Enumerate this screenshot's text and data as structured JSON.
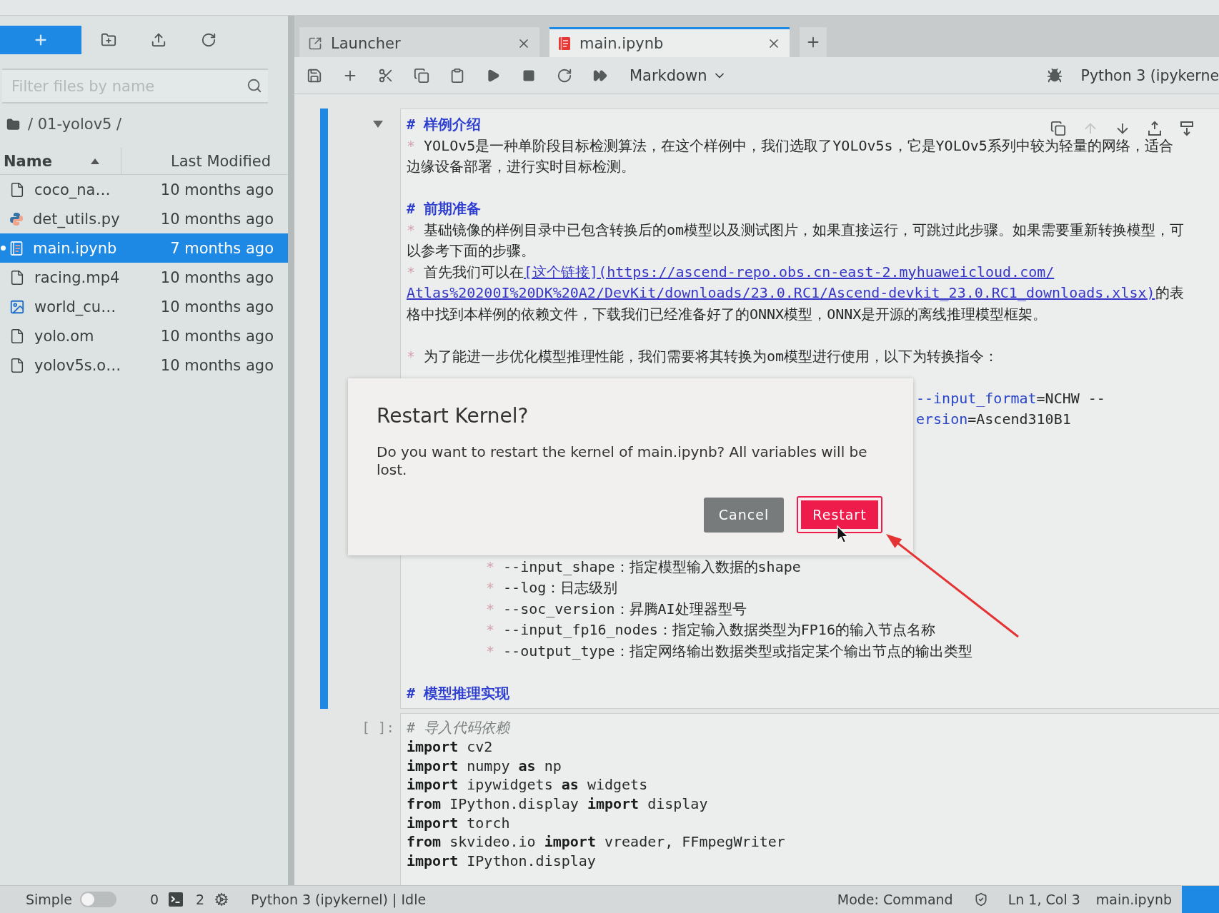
{
  "sidebar": {
    "filter": {
      "placeholder": "Filter files by name"
    },
    "path": "/ 01-yolov5 /",
    "columns": [
      {
        "label": "Name",
        "sorted": true
      },
      {
        "label": "Last Modified",
        "sorted": false
      }
    ],
    "files": [
      {
        "name": "coco_na…",
        "modified": "10 months ago",
        "kind": "file",
        "selected": false,
        "running": false
      },
      {
        "name": "det_utils.py",
        "modified": "10 months ago",
        "kind": "python",
        "selected": false,
        "running": false
      },
      {
        "name": "main.ipynb",
        "modified": "7 months ago",
        "kind": "notebook",
        "selected": true,
        "running": true
      },
      {
        "name": "racing.mp4",
        "modified": "10 months ago",
        "kind": "file",
        "selected": false,
        "running": false
      },
      {
        "name": "world_cu…",
        "modified": "10 months ago",
        "kind": "image",
        "selected": false,
        "running": false
      },
      {
        "name": "yolo.om",
        "modified": "10 months ago",
        "kind": "file",
        "selected": false,
        "running": false
      },
      {
        "name": "yolov5s.o…",
        "modified": "10 months ago",
        "kind": "file",
        "selected": false,
        "running": false
      }
    ]
  },
  "tabs": [
    {
      "label": "Launcher",
      "kind": "launcher",
      "selected": false
    },
    {
      "label": "main.ipynb",
      "kind": "notebook",
      "selected": true
    }
  ],
  "toolbar": {
    "cell_type": "Markdown",
    "kernel": "Python 3 (ipykerne"
  },
  "markdown_cell": {
    "selected": true,
    "cell_toolbar": [
      {
        "kind": "duplicate",
        "disabled": false
      },
      {
        "kind": "move_up",
        "disabled": true
      },
      {
        "kind": "move_down",
        "disabled": false
      },
      {
        "kind": "insert_above",
        "disabled": false
      },
      {
        "kind": "insert_below",
        "disabled": false
      }
    ],
    "lines": [
      {
        "kind": "heading",
        "segments": [
          {
            "text": "# 样例介绍",
            "kind": "plain"
          }
        ]
      },
      {
        "kind": "item",
        "marker": "*",
        "segments": [
          {
            "text": "YOLOv5是一种单阶段目标检测算法，在这个样例中，我们选取了YOLOv5s，它是YOLOv5系列中较为轻量的网络，适合",
            "kind": "plain"
          }
        ]
      },
      {
        "kind": "continuation",
        "segments": [
          {
            "text": "边缘设备部署，进行实时目标检测。",
            "kind": "plain"
          }
        ]
      },
      {
        "kind": "blank"
      },
      {
        "kind": "heading",
        "segments": [
          {
            "text": "# 前期准备",
            "kind": "plain"
          }
        ]
      },
      {
        "kind": "item",
        "marker": "*",
        "segments": [
          {
            "text": "基础镜像的样例目录中已包含转换后的om模型以及测试图片，如果直接运行，可跳过此步骤。如果需要重新转换模型，可",
            "kind": "plain"
          }
        ]
      },
      {
        "kind": "continuation",
        "segments": [
          {
            "text": "以参考下面的步骤。",
            "kind": "plain"
          }
        ]
      },
      {
        "kind": "item",
        "marker": "*",
        "segments": [
          {
            "text": "首先我们可以在",
            "kind": "plain"
          },
          {
            "text": "[这个链接](https://ascend-repo.obs.cn-east-2.myhuaweicloud.com/",
            "kind": "link"
          }
        ]
      },
      {
        "kind": "continuation",
        "segments": [
          {
            "text": "Atlas%20200I%20DK%20A2/DevKit/downloads/23.0.RC1/Ascend-devkit_23.0.RC1_downloads.xlsx)",
            "kind": "link"
          },
          {
            "text": "的表",
            "kind": "plain"
          }
        ]
      },
      {
        "kind": "continuation",
        "segments": [
          {
            "text": "格中找到本样例的依赖文件，下载我们已经准备好了的ONNX模型，ONNX是开源的离线推理模型框架。",
            "kind": "plain"
          }
        ]
      },
      {
        "kind": "blank"
      },
      {
        "kind": "item",
        "marker": "*",
        "segments": [
          {
            "text": "为了能进一步优化模型推理性能，我们需要将其转换为om模型进行使用，以下为转换指令：",
            "kind": "plain"
          }
        ]
      },
      {
        "kind": "covered"
      },
      {
        "kind": "covered",
        "segments": [
          {
            "text": "--input_format",
            "kind": "option"
          },
          {
            "text": "=NCHW --",
            "kind": "plain"
          }
        ]
      },
      {
        "kind": "covered",
        "segments": [
          {
            "text": "ersion",
            "kind": "option"
          },
          {
            "text": "=Ascend310B1",
            "kind": "plain"
          }
        ]
      },
      {
        "kind": "covered"
      },
      {
        "kind": "covered"
      },
      {
        "kind": "covered"
      },
      {
        "kind": "covered"
      },
      {
        "kind": "covered"
      },
      {
        "kind": "covered"
      },
      {
        "kind": "subitem",
        "marker": "*",
        "segments": [
          {
            "text": "--input_shape：指定模型输入数据的shape",
            "kind": "plain"
          }
        ]
      },
      {
        "kind": "subitem",
        "marker": "*",
        "segments": [
          {
            "text": "--log：日志级别",
            "kind": "plain"
          }
        ]
      },
      {
        "kind": "subitem",
        "marker": "*",
        "segments": [
          {
            "text": "--soc_version：昇腾AI处理器型号",
            "kind": "plain"
          }
        ]
      },
      {
        "kind": "subitem",
        "marker": "*",
        "segments": [
          {
            "text": "--input_fp16_nodes：指定输入数据类型为FP16的输入节点名称",
            "kind": "plain"
          }
        ]
      },
      {
        "kind": "subitem",
        "marker": "*",
        "segments": [
          {
            "text": "--output_type：指定网络输出数据类型或指定某个输出节点的输出类型",
            "kind": "plain"
          }
        ]
      },
      {
        "kind": "blank"
      },
      {
        "kind": "heading",
        "segments": [
          {
            "text": "# 模型推理实现",
            "kind": "plain"
          }
        ]
      }
    ]
  },
  "code_cell": {
    "prompt": "[ ]:",
    "lines": [
      {
        "segments": [
          {
            "text": "# 导入代码依赖",
            "kind": "comment"
          }
        ]
      },
      {
        "segments": [
          {
            "text": "import",
            "kind": "keyword"
          },
          {
            "text": " cv2",
            "kind": "plain"
          }
        ]
      },
      {
        "segments": [
          {
            "text": "import",
            "kind": "keyword"
          },
          {
            "text": " numpy ",
            "kind": "plain"
          },
          {
            "text": "as",
            "kind": "keyword"
          },
          {
            "text": " np",
            "kind": "plain"
          }
        ]
      },
      {
        "segments": [
          {
            "text": "import",
            "kind": "keyword"
          },
          {
            "text": " ipywidgets ",
            "kind": "plain"
          },
          {
            "text": "as",
            "kind": "keyword"
          },
          {
            "text": " widgets",
            "kind": "plain"
          }
        ]
      },
      {
        "segments": [
          {
            "text": "from",
            "kind": "keyword"
          },
          {
            "text": " IPython.display ",
            "kind": "plain"
          },
          {
            "text": "import",
            "kind": "keyword"
          },
          {
            "text": " display",
            "kind": "plain"
          }
        ]
      },
      {
        "segments": [
          {
            "text": "import",
            "kind": "keyword"
          },
          {
            "text": " torch",
            "kind": "plain"
          }
        ]
      },
      {
        "segments": [
          {
            "text": "from",
            "kind": "keyword"
          },
          {
            "text": " skvideo.io ",
            "kind": "plain"
          },
          {
            "text": "import",
            "kind": "keyword"
          },
          {
            "text": " vreader, FFmpegWriter",
            "kind": "plain"
          }
        ]
      },
      {
        "segments": [
          {
            "text": "import",
            "kind": "keyword"
          },
          {
            "text": " IPython.display",
            "kind": "plain"
          }
        ]
      }
    ]
  },
  "dialog": {
    "title": "Restart Kernel?",
    "body": "Do you want to restart the kernel of main.ipynb? All variables will be lost.",
    "buttons": [
      {
        "label": "Cancel",
        "kind": "reject",
        "focused": false
      },
      {
        "label": "Restart",
        "kind": "accept",
        "focused": true
      }
    ]
  },
  "status_bar": {
    "simple_mode": {
      "label": "Simple",
      "on": false
    },
    "terminals": "0",
    "kernels": "2",
    "kernel_status": "Python 3 (ipykernel) | Idle",
    "mode": "Mode: Command",
    "position": "Ln 1, Col 3",
    "file": "main.ipynb"
  }
}
